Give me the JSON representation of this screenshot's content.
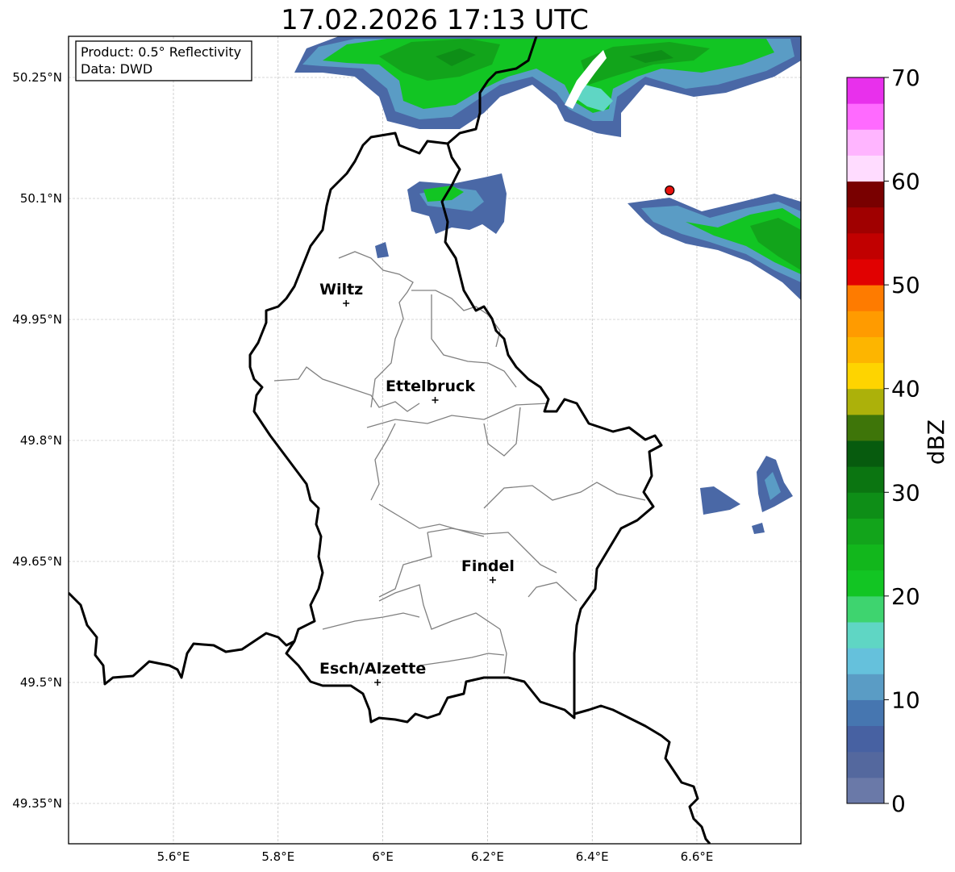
{
  "title": "17.02.2026 17:13 UTC",
  "info": {
    "product": "Product: 0.5° Reflectivity",
    "data": "Data: DWD"
  },
  "axes": {
    "lat_ticks": [
      {
        "value": 50.25,
        "label": "50.25°N"
      },
      {
        "value": 50.1,
        "label": "50.1°N"
      },
      {
        "value": 49.95,
        "label": "49.95°N"
      },
      {
        "value": 49.8,
        "label": "49.8°N"
      },
      {
        "value": 49.65,
        "label": "49.65°N"
      },
      {
        "value": 49.5,
        "label": "49.5°N"
      },
      {
        "value": 49.35,
        "label": "49.35°N"
      }
    ],
    "lon_ticks": [
      {
        "value": 5.6,
        "label": "5.6°E"
      },
      {
        "value": 5.8,
        "label": "5.8°E"
      },
      {
        "value": 6.0,
        "label": "6°E"
      },
      {
        "value": 6.2,
        "label": "6.2°E"
      },
      {
        "value": 6.4,
        "label": "6.4°E"
      },
      {
        "value": 6.6,
        "label": "6.6°E"
      }
    ],
    "lon_range": [
      5.4,
      6.8
    ],
    "lat_range": [
      49.3,
      50.3
    ],
    "grid": true
  },
  "cities": [
    {
      "name": "Wiltz",
      "lon": 5.93,
      "lat": 49.97
    },
    {
      "name": "Ettelbruck",
      "lon": 6.1,
      "lat": 49.85
    },
    {
      "name": "Findel",
      "lon": 6.21,
      "lat": 49.627
    },
    {
      "name": "Esch/Alzette",
      "lon": 5.99,
      "lat": 49.5
    }
  ],
  "radar_site": {
    "lon": 6.548,
    "lat": 50.11,
    "color": "#e8120c"
  },
  "colorbar": {
    "label": "dBZ",
    "min": 0,
    "max": 70,
    "ticks": [
      "0",
      "10",
      "20",
      "30",
      "40",
      "50",
      "60",
      "70"
    ],
    "colors": [
      "#6a79a8",
      "#54689e",
      "#4761a2",
      "#4676b0",
      "#5a9cc5",
      "#65c1dc",
      "#5fd6c4",
      "#3ed46f",
      "#12c523",
      "#12b71c",
      "#12a41b",
      "#0e8e17",
      "#0b7511",
      "#075b0e",
      "#3e7509",
      "#acb10a",
      "#fed400",
      "#fdb500",
      "#ff9b00",
      "#fe7b00",
      "#e10101",
      "#c10000",
      "#a00000",
      "#790000",
      "#ffdcff",
      "#ffb5ff",
      "#ff6aff",
      "#e830ec"
    ]
  }
}
